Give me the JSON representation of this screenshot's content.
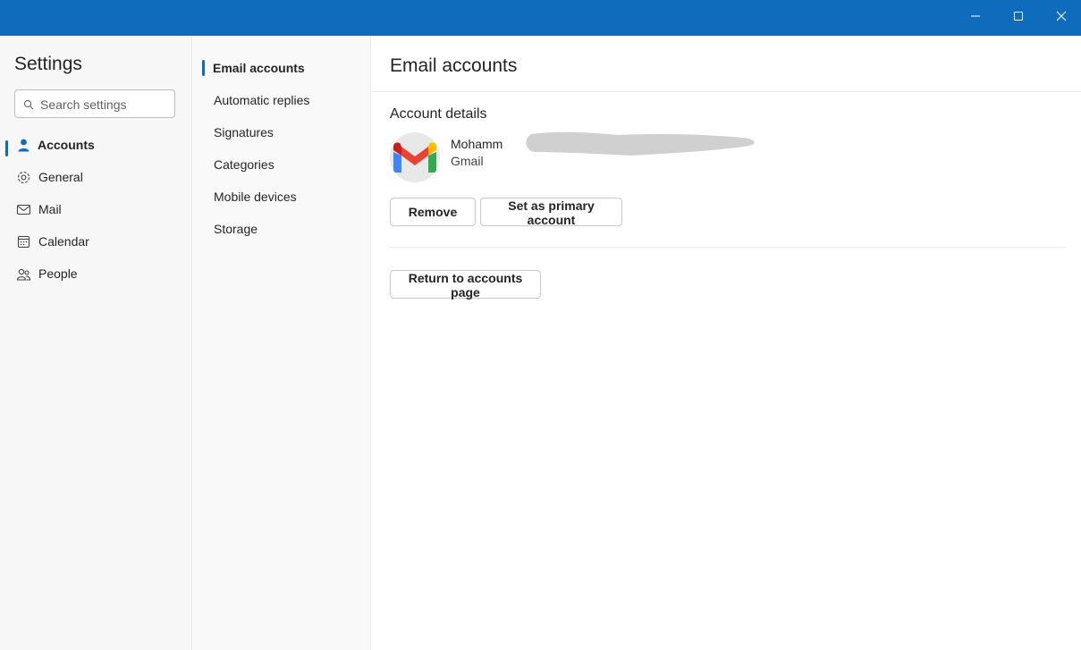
{
  "window": {
    "controls": [
      "minimize-icon",
      "maximize-icon",
      "close-icon"
    ],
    "titlebar_color": "#0f6cbd"
  },
  "sidebar": {
    "title": "Settings",
    "search_placeholder": "Search settings",
    "items": [
      {
        "label": "Accounts",
        "icon": "person-icon",
        "selected": true
      },
      {
        "label": "General",
        "icon": "gear-icon",
        "selected": false
      },
      {
        "label": "Mail",
        "icon": "mail-icon",
        "selected": false
      },
      {
        "label": "Calendar",
        "icon": "calendar-icon",
        "selected": false
      },
      {
        "label": "People",
        "icon": "people-icon",
        "selected": false
      }
    ]
  },
  "subnav": {
    "items": [
      {
        "label": "Email accounts",
        "selected": true
      },
      {
        "label": "Automatic replies",
        "selected": false
      },
      {
        "label": "Signatures",
        "selected": false
      },
      {
        "label": "Categories",
        "selected": false
      },
      {
        "label": "Mobile devices",
        "selected": false
      },
      {
        "label": "Storage",
        "selected": false
      }
    ]
  },
  "main": {
    "title": "Email accounts",
    "section_title": "Account details",
    "account": {
      "name_visible": "Mohamm",
      "type": "Gmail",
      "avatar_icon": "gmail-icon"
    },
    "buttons": {
      "remove": "Remove",
      "set_primary": "Set as primary account",
      "return": "Return to accounts page"
    }
  },
  "colors": {
    "accent": "#0f6cbd"
  }
}
